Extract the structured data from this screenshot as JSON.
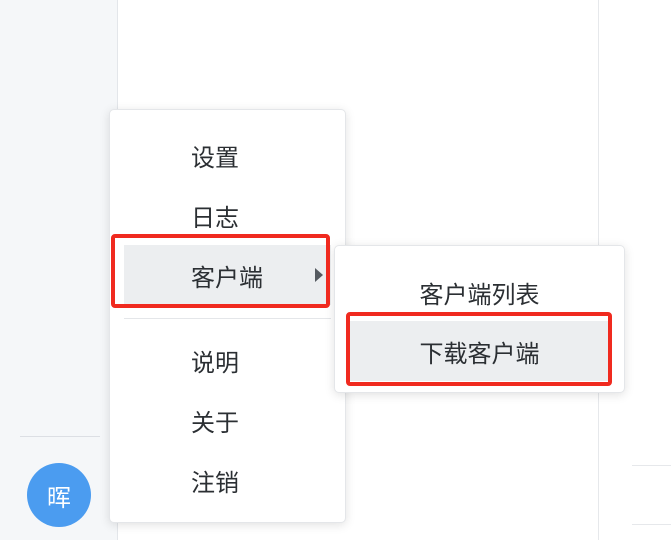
{
  "user": {
    "avatar_text": "晖"
  },
  "context_menu": {
    "items": [
      {
        "label": "设置"
      },
      {
        "label": "日志"
      },
      {
        "label": "客户端"
      },
      {
        "label": "说明"
      },
      {
        "label": "关于"
      },
      {
        "label": "注销"
      }
    ]
  },
  "submenu": {
    "items": [
      {
        "label": "客户端列表"
      },
      {
        "label": "下载客户端"
      }
    ]
  },
  "colors": {
    "avatar_bg": "#4b9cf0",
    "highlight": "#f02a1f",
    "active_bg": "#eceef0"
  }
}
